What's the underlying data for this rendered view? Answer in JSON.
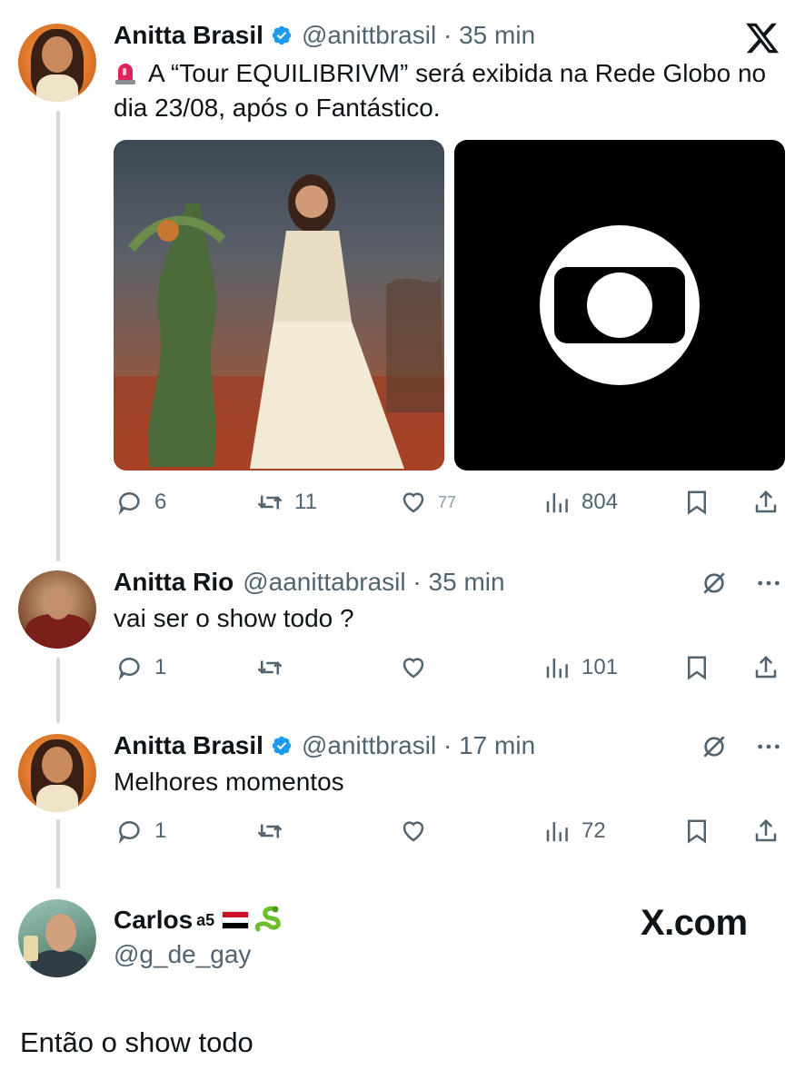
{
  "tweets": [
    {
      "name": "Anitta Brasil",
      "handle": "@anittbrasil",
      "time": "35 min",
      "text": "A “Tour EQUILIBRIVM” será exibida na Rede Globo no dia 23/08, após o Fantástico.",
      "icon": "siren-emoji",
      "replies": "6",
      "retweets": "11",
      "likes": "77",
      "views": "804"
    },
    {
      "name": "Anitta Rio",
      "handle": "@aanittabrasil",
      "time": "35 min",
      "text": "vai ser o show todo ?",
      "replies": "1",
      "views": "101"
    },
    {
      "name": "Anitta Brasil",
      "handle": "@anittbrasil",
      "time": "17 min",
      "text": "Melhores momentos",
      "replies": "1",
      "views": "72"
    }
  ],
  "reply_card": {
    "name": "Carlos",
    "superscript": "a5",
    "handle": "@g_de_gay",
    "brand": "X.com",
    "text": "Então o show todo"
  },
  "colors": {
    "accent": "#1d9bf0",
    "text": "#0f1419",
    "muted": "#536471",
    "thread_line": "#cfd9de"
  }
}
